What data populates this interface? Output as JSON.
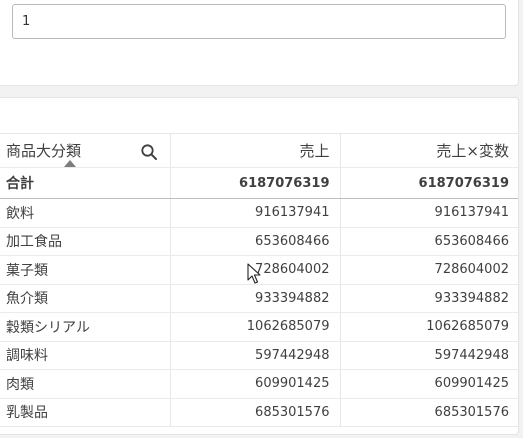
{
  "filter_input": {
    "value": "1"
  },
  "table": {
    "headers": [
      "商品大分類",
      "売上",
      "売上×変数"
    ],
    "total": {
      "label": "合計",
      "sales": "6187076319",
      "sales_x_var": "6187076319"
    },
    "rows": [
      {
        "label": "飲料",
        "sales": "916137941",
        "sales_x_var": "916137941"
      },
      {
        "label": "加工食品",
        "sales": "653608466",
        "sales_x_var": "653608466"
      },
      {
        "label": "菓子類",
        "sales": "728604002",
        "sales_x_var": "728604002"
      },
      {
        "label": "魚介類",
        "sales": "933394882",
        "sales_x_var": "933394882"
      },
      {
        "label": "穀類シリアル",
        "sales": "1062685079",
        "sales_x_var": "1062685079"
      },
      {
        "label": "調味料",
        "sales": "597442948",
        "sales_x_var": "597442948"
      },
      {
        "label": "肉類",
        "sales": "609901425",
        "sales_x_var": "609901425"
      },
      {
        "label": "乳製品",
        "sales": "685301576",
        "sales_x_var": "685301576"
      }
    ]
  }
}
